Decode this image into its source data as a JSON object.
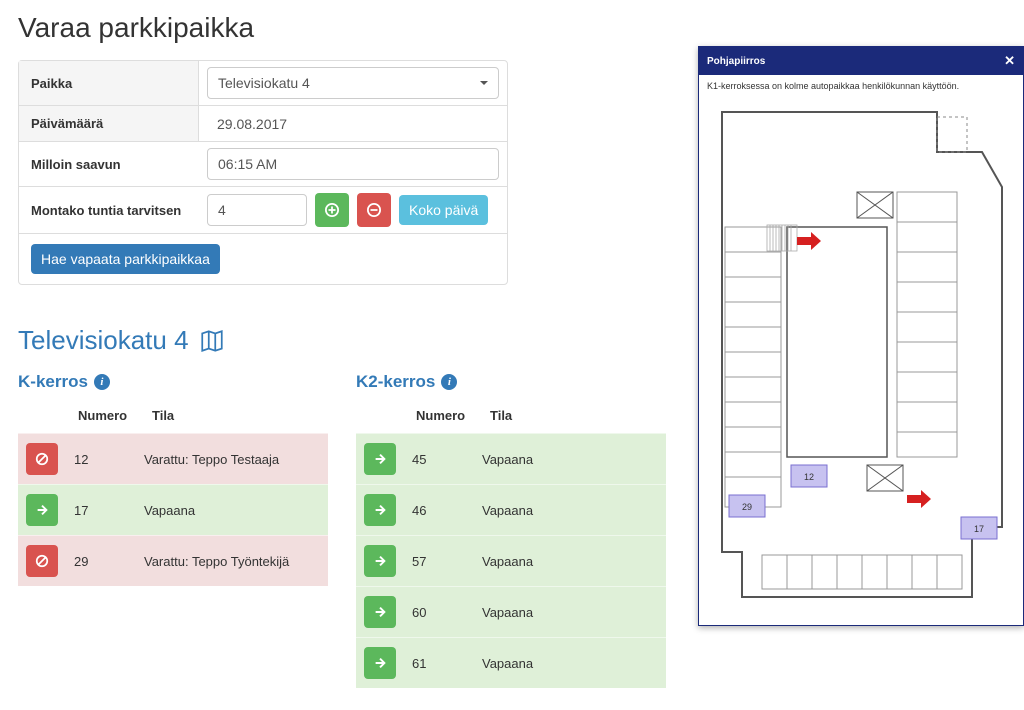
{
  "page_title": "Varaa parkkipaikka",
  "form": {
    "place_label": "Paikka",
    "place_value": "Televisiokatu 4",
    "date_label": "Päivämäärä",
    "date_value": "29.08.2017",
    "arrival_label": "Milloin saavun",
    "arrival_value": "06:15 AM",
    "hours_label": "Montako tuntia tarvitsen",
    "hours_value": "4",
    "full_day_label": "Koko päivä",
    "search_label": "Hae vapaata parkkipaikkaa"
  },
  "results": {
    "location_title": "Televisiokatu 4",
    "col_numero": "Numero",
    "col_tila": "Tila",
    "floor1": {
      "title": "K-kerros",
      "rows": [
        {
          "num": "12",
          "state": "Varattu: Teppo Testaaja",
          "free": false
        },
        {
          "num": "17",
          "state": "Vapaana",
          "free": true
        },
        {
          "num": "29",
          "state": "Varattu: Teppo Työntekijä",
          "free": false
        }
      ]
    },
    "floor2": {
      "title": "K2-kerros",
      "rows": [
        {
          "num": "45",
          "state": "Vapaana",
          "free": true
        },
        {
          "num": "46",
          "state": "Vapaana",
          "free": true
        },
        {
          "num": "57",
          "state": "Vapaana",
          "free": true
        },
        {
          "num": "60",
          "state": "Vapaana",
          "free": true
        },
        {
          "num": "61",
          "state": "Vapaana",
          "free": true
        }
      ]
    }
  },
  "floorplan": {
    "title": "Pohjapiirros",
    "subtitle": "K1-kerroksessa on kolme autopaikkaa henkilökunnan käyttöön.",
    "spots": {
      "s12": "12",
      "s17": "17",
      "s29": "29"
    }
  }
}
